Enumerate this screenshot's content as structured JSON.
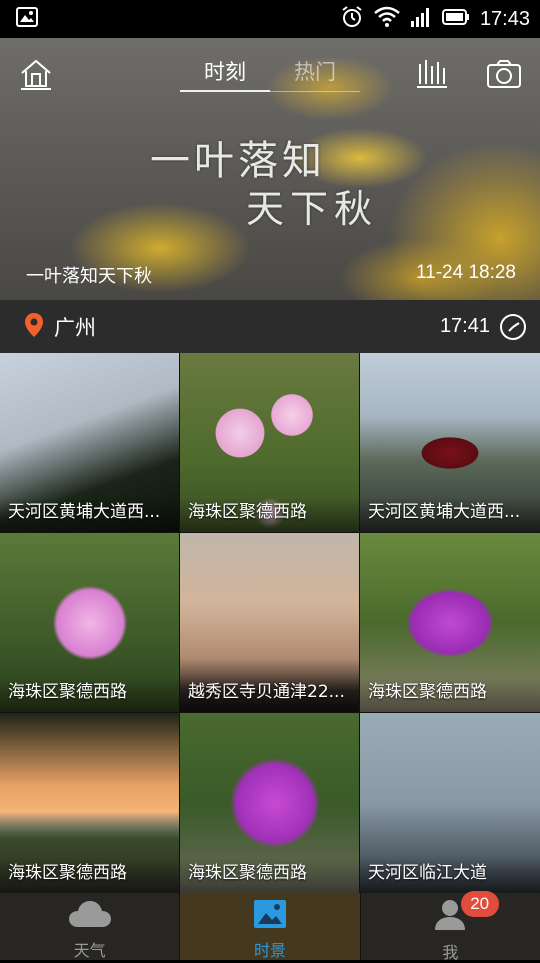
{
  "status_bar": {
    "time": "17:43",
    "icons": [
      "gallery-notification-icon",
      "alarm-icon",
      "wifi-icon",
      "signal-icon",
      "battery-icon"
    ]
  },
  "header": {
    "tabs": [
      {
        "label": "时刻",
        "active": true
      },
      {
        "label": "热门",
        "active": false
      }
    ],
    "icons": [
      "home-icon",
      "chart-icon",
      "camera-icon"
    ]
  },
  "hero": {
    "calligraphy_line1": "一叶落知",
    "calligraphy_line2": "天下秋",
    "caption": "一叶落知天下秋",
    "datetime": "11-24 18:28"
  },
  "location": {
    "city": "广州",
    "time": "17:41",
    "accent_color": "#f0622a"
  },
  "photos": [
    {
      "label": "天河区黄埔大道西..."
    },
    {
      "label": "海珠区聚德西路"
    },
    {
      "label": "天河区黄埔大道西..."
    },
    {
      "label": "海珠区聚德西路"
    },
    {
      "label": "越秀区寺贝通津22..."
    },
    {
      "label": "海珠区聚德西路"
    },
    {
      "label": "海珠区聚德西路"
    },
    {
      "label": "海珠区聚德西路"
    },
    {
      "label": "天河区临江大道"
    }
  ],
  "tab_bar": {
    "items": [
      {
        "label": "天气",
        "icon": "cloud-icon",
        "active": false
      },
      {
        "label": "时景",
        "icon": "image-icon",
        "active": true
      },
      {
        "label": "我",
        "icon": "person-icon",
        "active": false,
        "badge": "20"
      }
    ],
    "active_color": "#2a9ae0",
    "badge_color": "#e24c3c"
  }
}
